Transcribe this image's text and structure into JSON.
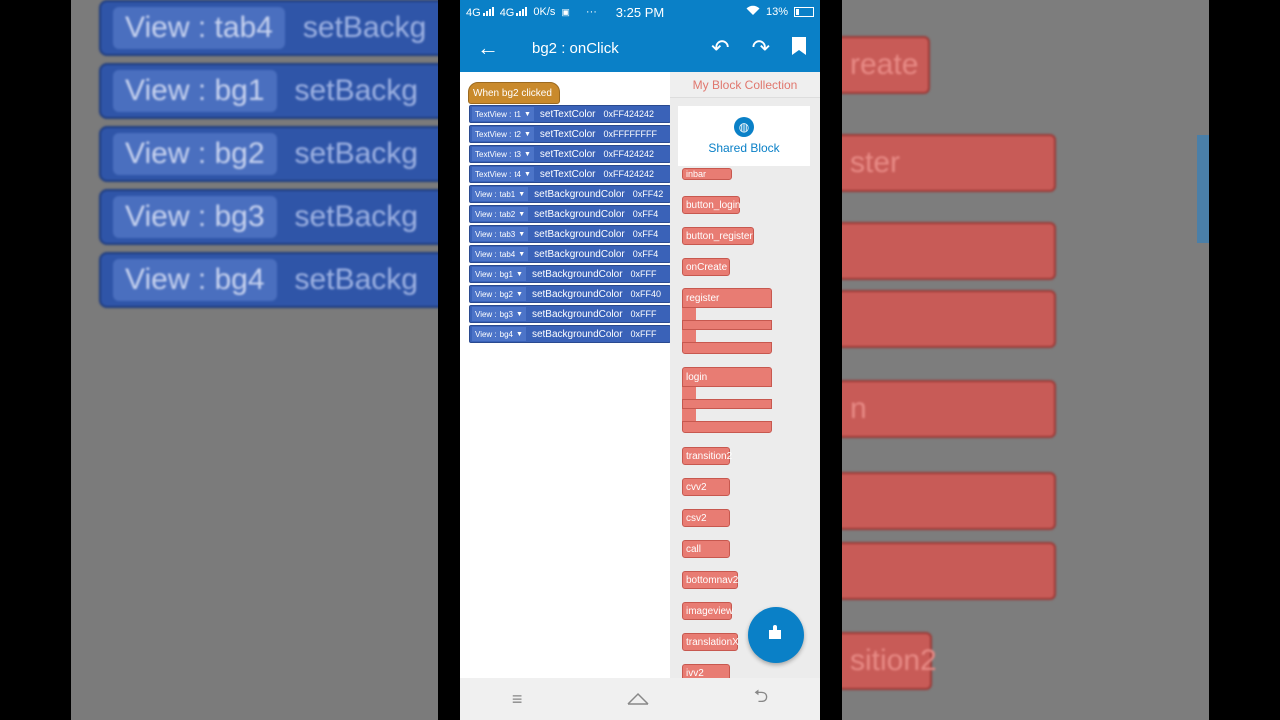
{
  "background": {
    "left_blocks": [
      {
        "selector": "View : tab4",
        "method": "setBackg"
      },
      {
        "selector": "View : bg1",
        "method": "setBackg"
      },
      {
        "selector": "View : bg2",
        "method": "setBackg"
      },
      {
        "selector": "View : bg3",
        "method": "setBackg"
      },
      {
        "selector": "View : bg4",
        "method": "setBackg"
      }
    ],
    "right_blocks": [
      "reate",
      "ster",
      "",
      "n",
      "",
      "",
      "sition2"
    ]
  },
  "status_bar": {
    "network1": "4G",
    "network2": "4G",
    "speed": "0K/s",
    "time": "3:25 PM",
    "battery": "13%",
    "dots": "···"
  },
  "app_bar": {
    "title": "bg2 : onClick",
    "back_icon": "←",
    "undo_icon": "↶",
    "redo_icon": "↷",
    "bookmark_icon": "bookmark"
  },
  "workspace": {
    "event_label": "When bg2 clicked",
    "blocks": [
      {
        "selector_type": "TextView :",
        "selector_value": "t1",
        "method": "setTextColor",
        "value": "0xFF424242"
      },
      {
        "selector_type": "TextView :",
        "selector_value": "t2",
        "method": "setTextColor",
        "value": "0xFFFFFFFF"
      },
      {
        "selector_type": "TextView :",
        "selector_value": "t3",
        "method": "setTextColor",
        "value": "0xFF424242"
      },
      {
        "selector_type": "TextView :",
        "selector_value": "t4",
        "method": "setTextColor",
        "value": "0xFF424242"
      },
      {
        "selector_type": "View :",
        "selector_value": "tab1",
        "method": "setBackgroundColor",
        "value": "0xFF42"
      },
      {
        "selector_type": "View :",
        "selector_value": "tab2",
        "method": "setBackgroundColor",
        "value": "0xFF4"
      },
      {
        "selector_type": "View :",
        "selector_value": "tab3",
        "method": "setBackgroundColor",
        "value": "0xFF4"
      },
      {
        "selector_type": "View :",
        "selector_value": "tab4",
        "method": "setBackgroundColor",
        "value": "0xFF4"
      },
      {
        "selector_type": "View :",
        "selector_value": "bg1",
        "method": "setBackgroundColor",
        "value": "0xFFF"
      },
      {
        "selector_type": "View :",
        "selector_value": "bg2",
        "method": "setBackgroundColor",
        "value": "0xFF40"
      },
      {
        "selector_type": "View :",
        "selector_value": "bg3",
        "method": "setBackgroundColor",
        "value": "0xFFF"
      },
      {
        "selector_type": "View :",
        "selector_value": "bg4",
        "method": "setBackgroundColor",
        "value": "0xFFF"
      }
    ]
  },
  "palette": {
    "header": "My Block Collection",
    "shared_label": "Shared Block",
    "partial_top": "inbar",
    "simple_blocks": [
      {
        "label": "button_login"
      },
      {
        "label": "button_register"
      },
      {
        "label": "onCreate"
      }
    ],
    "container_blocks": [
      {
        "label": "register"
      },
      {
        "label": "login"
      }
    ],
    "lower_blocks": [
      {
        "label": "transition2"
      },
      {
        "label": "cvv2"
      },
      {
        "label": "csv2"
      },
      {
        "label": "call"
      },
      {
        "label": "bottomnav2"
      },
      {
        "label": "imageview"
      },
      {
        "label": "translationX"
      },
      {
        "label": "ivv2"
      }
    ]
  },
  "fab_icon": "puzzle",
  "nav_bar": {
    "menu_icon": "≡",
    "home_icon": "⌂",
    "back_icon": "⮌"
  },
  "colors": {
    "primary": "#0a80c7",
    "event": "#c98a2c",
    "statement": "#3a62b8",
    "custom_block": "#e87c73"
  }
}
